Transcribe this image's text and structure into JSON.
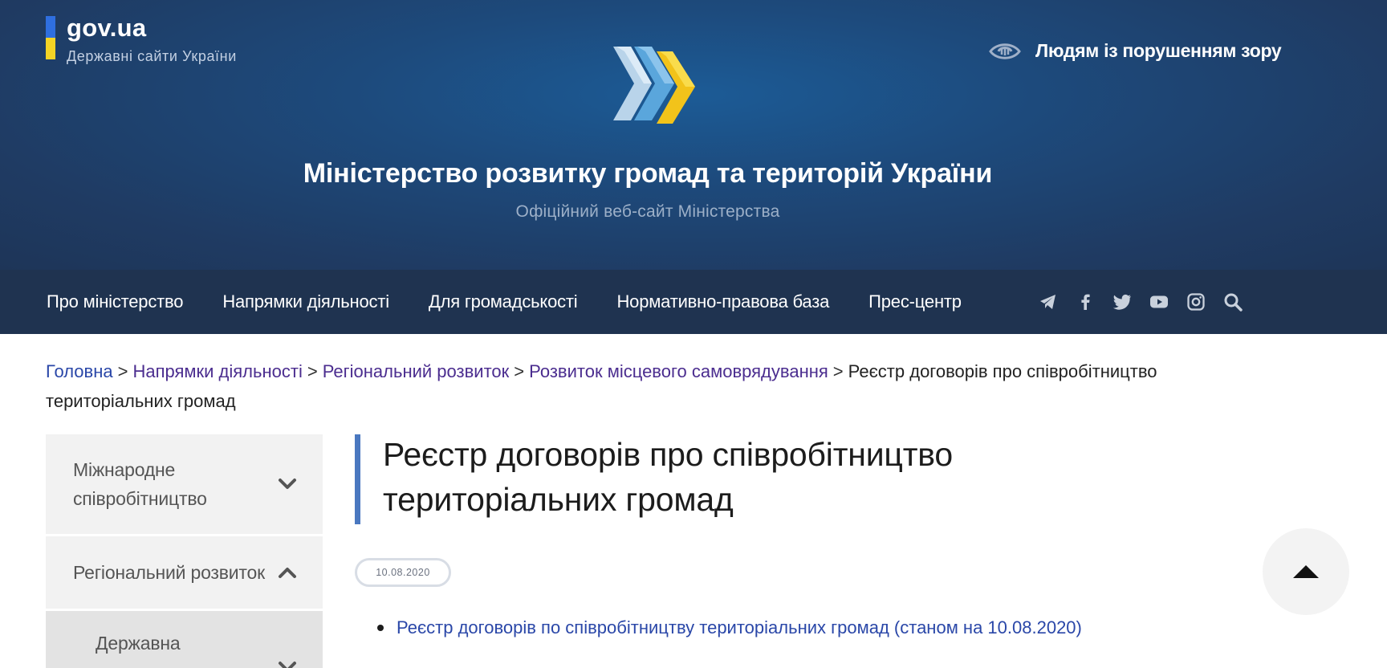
{
  "govua": {
    "title": "gov.ua",
    "subtitle": "Державні сайти України"
  },
  "accessibility": {
    "label": "Людям із порушенням зору",
    "icon": "eye-icon"
  },
  "site": {
    "title": "Міністерство розвитку громад та територій України",
    "subtitle": "Офіційний веб-сайт Міністерства"
  },
  "nav": {
    "items": [
      {
        "label": "Про міністерство"
      },
      {
        "label": "Напрямки діяльності"
      },
      {
        "label": "Для громадськості"
      },
      {
        "label": "Нормативно-правова база"
      },
      {
        "label": "Прес-центр"
      }
    ],
    "icons": [
      "telegram-icon",
      "facebook-icon",
      "twitter-icon",
      "youtube-icon",
      "instagram-icon",
      "search-icon"
    ]
  },
  "breadcrumb": {
    "items": [
      {
        "label": "Головна"
      },
      {
        "label": "Напрямки діяльності"
      },
      {
        "label": "Регіональний розвиток"
      },
      {
        "label": "Розвиток місцевого самоврядування"
      }
    ],
    "separator": ">",
    "current": "Реєстр договорів про співробітництво територіальних громад"
  },
  "sidebar": {
    "items": [
      {
        "label": "Міжнародне співробітництво",
        "state": "collapsed"
      },
      {
        "label": "Регіональний розвиток",
        "state": "expanded"
      },
      {
        "label": "Державна",
        "state": "collapsed"
      }
    ]
  },
  "page": {
    "title": "Реєстр договорів про співробітництво територіальних громад",
    "date": "10.08.2020",
    "links": [
      {
        "label": "Реєстр договорів по співробітництву територіальних громад (станом на 10.08.2020)"
      }
    ]
  },
  "colors": {
    "header_bg": "#1f3b63",
    "nav_bg": "#1f3350",
    "link": "#2a47a8",
    "accent_bar": "#4a78c0",
    "flag_blue": "#2f6fe0",
    "flag_yellow": "#f5d425"
  }
}
